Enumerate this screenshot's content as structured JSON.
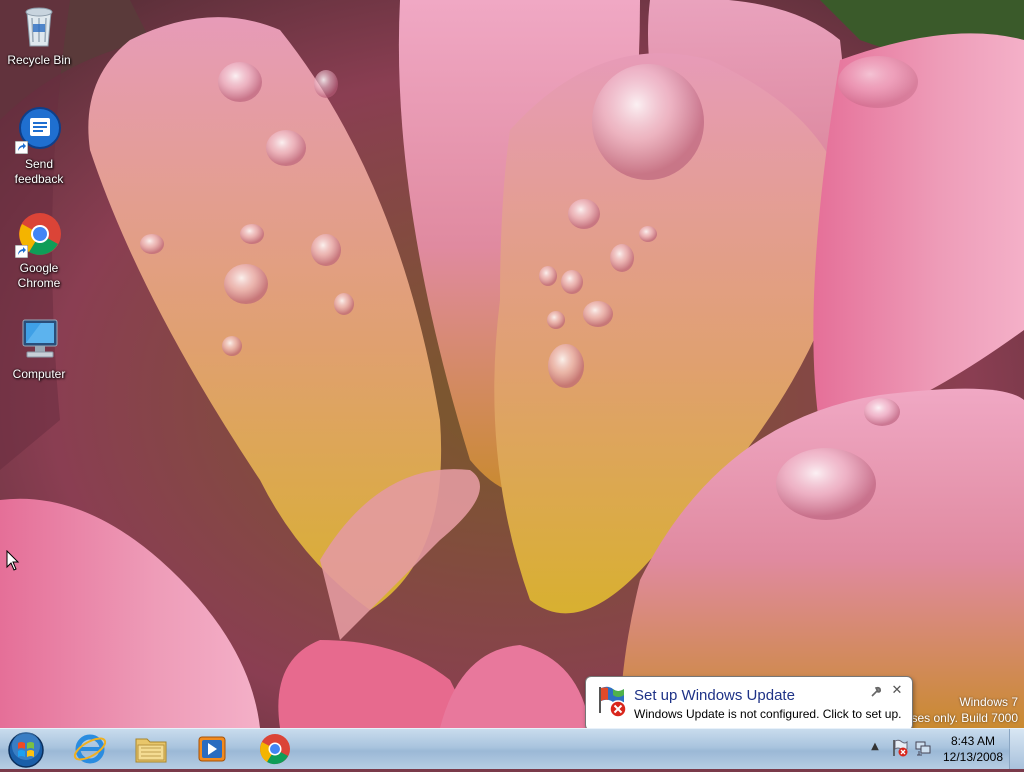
{
  "desktop": {
    "icons": [
      {
        "label_lines": [
          "Recycle Bin"
        ],
        "icon": "recycle-bin-icon"
      },
      {
        "label_lines": [
          "Send",
          "feedback"
        ],
        "icon": "send-feedback-icon"
      },
      {
        "label_lines": [
          "Google",
          "Chrome"
        ],
        "icon": "chrome-icon"
      },
      {
        "label_lines": [
          "Computer"
        ],
        "icon": "computer-icon"
      }
    ],
    "watermark": {
      "line1": "Windows 7",
      "line2": "oses only. Build 7000"
    }
  },
  "notification": {
    "title": "Set up Windows Update",
    "body": "Windows Update is not configured. Click to set up.",
    "icon": "windows-update-flag-icon",
    "close_glyph": "✕"
  },
  "taskbar": {
    "pinned": [
      {
        "name": "internet-explorer",
        "icon": "ie-icon"
      },
      {
        "name": "windows-explorer",
        "icon": "folder-icon"
      },
      {
        "name": "windows-media-player",
        "icon": "media-player-icon"
      },
      {
        "name": "google-chrome",
        "icon": "chrome-icon"
      }
    ],
    "tray": {
      "overflow_glyph": "▲",
      "clock_time": "8:43 AM",
      "clock_date": "12/13/2008"
    }
  },
  "colors": {
    "taskbar": "#a9c4de",
    "balloon_title": "#1e3287",
    "petal_pink": "#e08aa8",
    "petal_yellow": "#e8c84a"
  }
}
